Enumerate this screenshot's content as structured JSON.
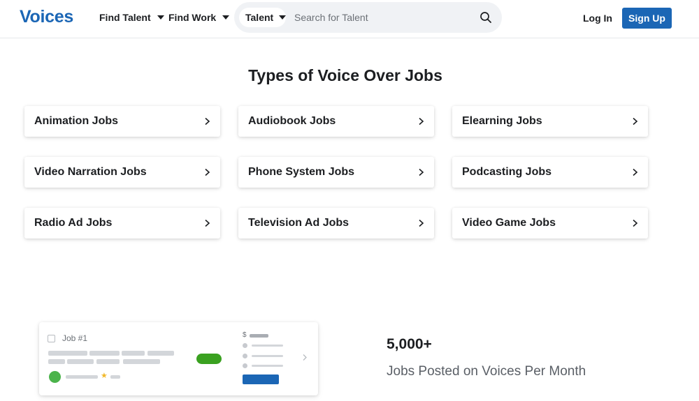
{
  "brand": {
    "logo_text": "Voices",
    "color": "#1b66b5"
  },
  "nav": {
    "find_talent": "Find Talent",
    "find_work": "Find Work"
  },
  "search": {
    "type_selected": "Talent",
    "placeholder": "Search for Talent",
    "icon": "search-icon"
  },
  "auth": {
    "login": "Log In",
    "signup": "Sign Up"
  },
  "section": {
    "title": "Types of Voice Over Jobs",
    "jobs": [
      "Animation Jobs",
      "Audiobook Jobs",
      "Elearning Jobs",
      "Video Narration Jobs",
      "Phone System Jobs",
      "Podcasting Jobs",
      "Radio Ad Jobs",
      "Television Ad Jobs",
      "Video Game Jobs"
    ]
  },
  "illustration": {
    "job_title": "Job #1",
    "dollar_sign": "$",
    "star": "★"
  },
  "stat": {
    "number": "5,000+",
    "label": "Jobs Posted on Voices Per Month"
  },
  "colors": {
    "primary": "#1b66b5",
    "green": "#3aa120",
    "star": "#f1b82a"
  }
}
